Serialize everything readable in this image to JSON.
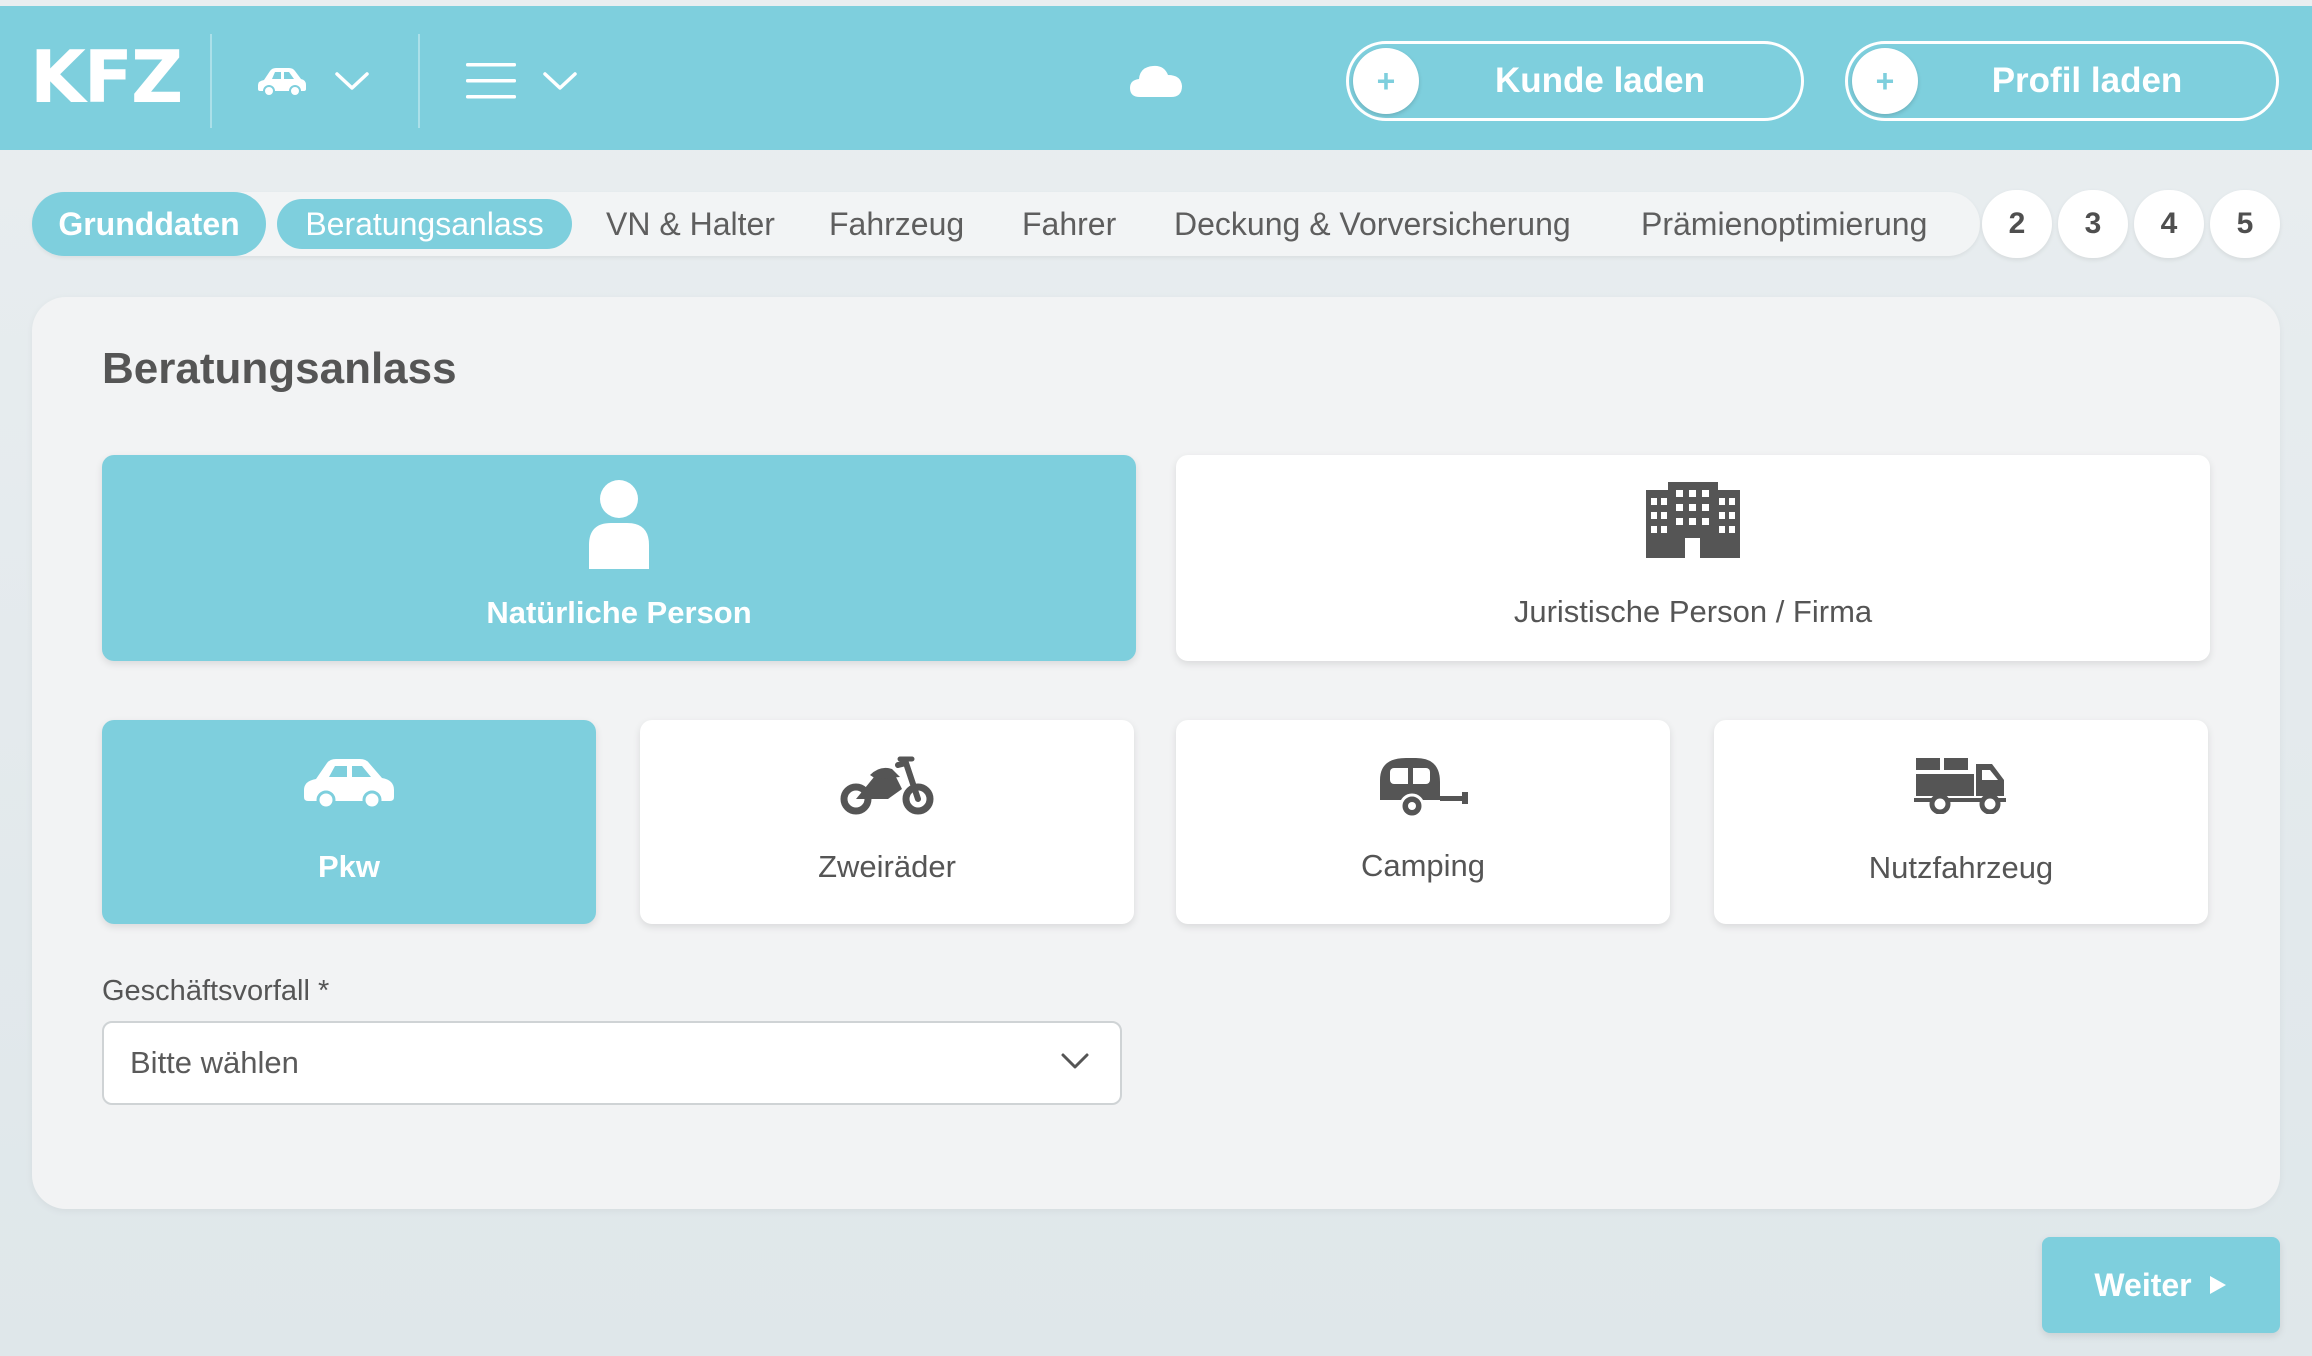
{
  "header": {
    "logo": "KFZ",
    "vehicle_menu_icon": "car-icon",
    "main_menu_icon": "hamburger-icon",
    "cloud_icon": "cloud-icon",
    "load_customer_label": "Kunde laden",
    "load_profile_label": "Profil laden",
    "plus_symbol": "+"
  },
  "tabs": {
    "items": [
      "Grunddaten",
      "Beratungsanlass",
      "VN & Halter",
      "Fahrzeug",
      "Fahrer",
      "Deckung & Vorversicherung",
      "Prämienoptimierung"
    ],
    "numbers": [
      "2",
      "3",
      "4",
      "5"
    ]
  },
  "card": {
    "title": "Beratungsanlass",
    "person_types": [
      {
        "label": "Natürliche Person",
        "icon": "person-icon",
        "selected": true
      },
      {
        "label": "Juristische Person / Firma",
        "icon": "building-icon",
        "selected": false
      }
    ],
    "vehicle_types": [
      {
        "label": "Pkw",
        "icon": "car-icon",
        "selected": true
      },
      {
        "label": "Zweiräder",
        "icon": "motorcycle-icon",
        "selected": false
      },
      {
        "label": "Camping",
        "icon": "caravan-icon",
        "selected": false
      },
      {
        "label": "Nutzfahrzeug",
        "icon": "truck-icon",
        "selected": false
      }
    ],
    "business_case": {
      "label": "Geschäftsvorfall *",
      "value": "Bitte wählen"
    }
  },
  "footer": {
    "next_label": "Weiter"
  },
  "colors": {
    "accent": "#7ecfdd",
    "text": "#555555",
    "background": "#e6ecee"
  }
}
